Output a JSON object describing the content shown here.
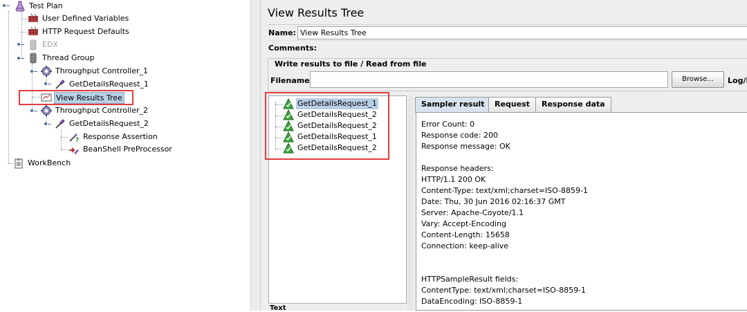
{
  "tree": {
    "test_plan": "Test Plan",
    "user_defined_variables": "User Defined Variables",
    "http_request_defaults": "HTTP Request Defaults",
    "edx": "EDX",
    "thread_group": "Thread Group",
    "throughput_controller_1": "Throughput Controller_1",
    "get_details_request_1": "GetDetailsRequest_1",
    "view_results_tree": "View Results Tree",
    "throughput_controller_2": "Throughput Controller_2",
    "get_details_request_2": "GetDetailsRequest_2",
    "response_assertion": "Response Assertion",
    "beanshell_preprocessor": "BeanShell PreProcessor",
    "workbench": "WorkBench"
  },
  "panel": {
    "title": "View Results Tree",
    "name_label": "Name:",
    "name_value": "View Results Tree",
    "comments_label": "Comments:",
    "file_group_title": "Write results to file / Read from file",
    "filename_label": "Filename",
    "filename_value": "",
    "browse_label": "Browse...",
    "log_display_label": "Log/D"
  },
  "results": [
    "GetDetailsRequest_1",
    "GetDetailsRequest_2",
    "GetDetailsRequest_2",
    "GetDetailsRequest_1",
    "GetDetailsRequest_2"
  ],
  "list_footer": "Text",
  "tabs": {
    "sampler_result": "Sampler result",
    "request": "Request",
    "response_data": "Response data"
  },
  "sampler_result": [
    "Error Count: 0",
    "Response code: 200",
    "Response message: OK",
    "",
    "Response headers:",
    "HTTP/1.1 200 OK",
    "Content-Type: text/xml;charset=ISO-8859-1",
    "Date: Thu, 30 Jun 2016 02:16:37 GMT",
    "Server: Apache-Coyote/1.1",
    "Vary: Accept-Encoding",
    "Content-Length: 15658",
    "Connection: keep-alive",
    "",
    "",
    "HTTPSampleResult fields:",
    "ContentType: text/xml;charset=ISO-8859-1",
    "DataEncoding: ISO-8859-1"
  ],
  "colors": {
    "highlight": "#e53b3b",
    "selection": "#b8cfe5",
    "panel_bg": "#eeeeee"
  }
}
